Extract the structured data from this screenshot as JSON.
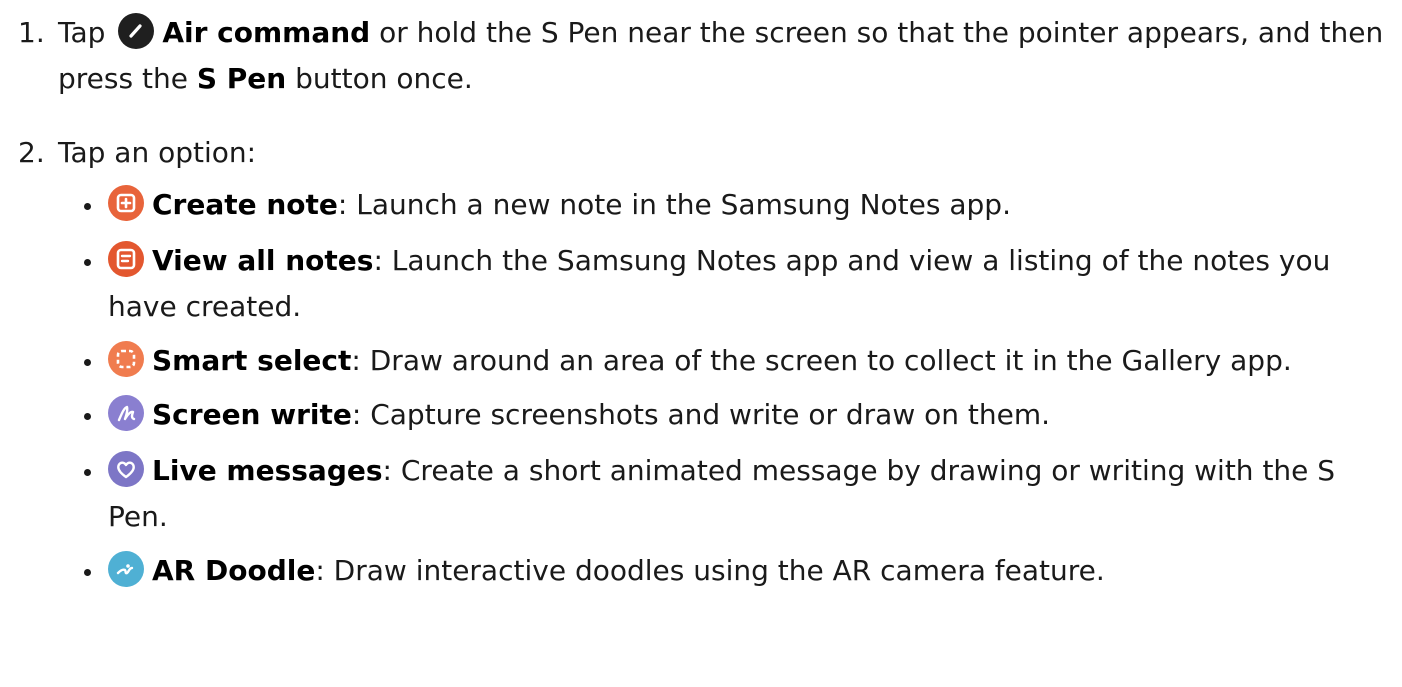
{
  "colors": {
    "air_command": "#1f1f1f",
    "create_note": "#e8643b",
    "view_all_notes": "#e3572f",
    "smart_select": "#f07c4f",
    "screen_write": "#8a7fd0",
    "live_messages": "#7d76c6",
    "ar_doodle": "#4fb0d4"
  },
  "steps": [
    {
      "number": "1.",
      "parts": {
        "tap": "Tap",
        "air_command": "Air command",
        "middle": "or hold the S Pen near the screen so that the pointer appears, and then press the",
        "s_pen": "S Pen",
        "end": "button once."
      },
      "icon": "air-command-pen-icon"
    },
    {
      "number": "2.",
      "text": "Tap an option:"
    }
  ],
  "options": [
    {
      "icon": "create-note-icon",
      "term": "Create note",
      "desc": ": Launch a new note in the Samsung Notes app."
    },
    {
      "icon": "view-all-notes-icon",
      "term": "View all notes",
      "desc": ": Launch the Samsung Notes app and view a listing of the notes you have created."
    },
    {
      "icon": "smart-select-icon",
      "term": "Smart select",
      "desc": ": Draw around an area of the screen to collect it in the Gallery app."
    },
    {
      "icon": "screen-write-icon",
      "term": "Screen write",
      "desc": ": Capture screenshots and write or draw on them."
    },
    {
      "icon": "live-messages-icon",
      "term": "Live messages",
      "desc": ": Create a short animated message by drawing or writing with the S Pen."
    },
    {
      "icon": "ar-doodle-icon",
      "term": "AR Doodle",
      "desc": ": Draw interactive doodles using the AR camera feature."
    }
  ]
}
